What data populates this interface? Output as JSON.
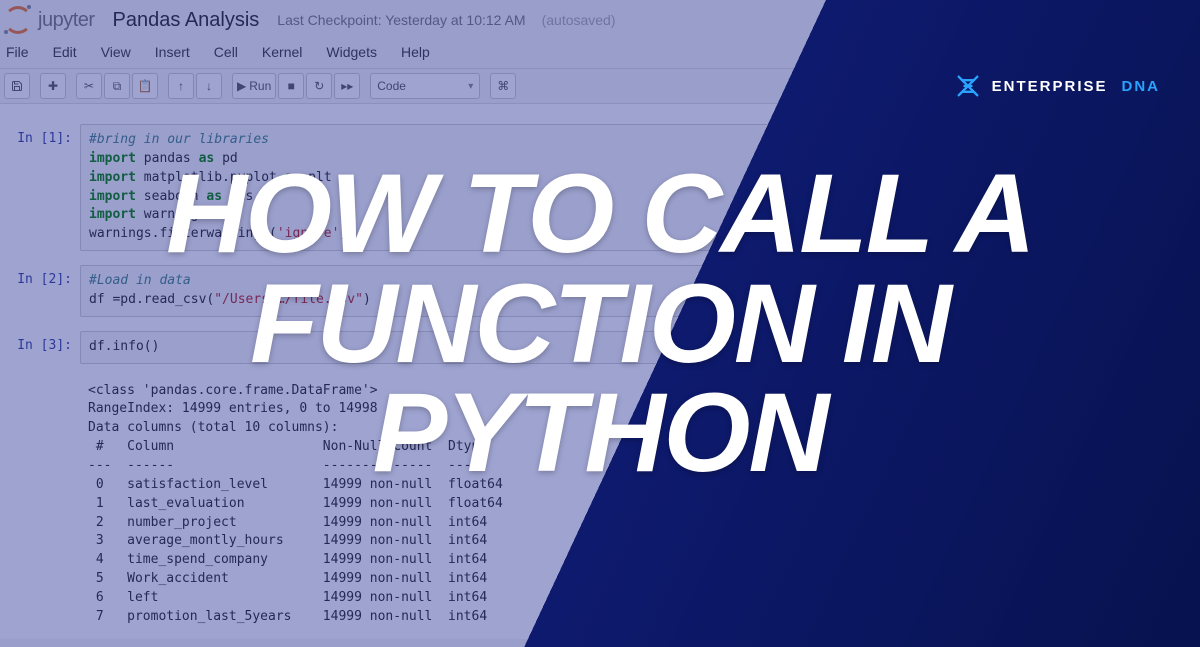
{
  "header": {
    "logo_text": "jupyter",
    "title": "Pandas Analysis",
    "checkpoint": "Last Checkpoint: Yesterday at 10:12 AM",
    "autosaved": "(autosaved)"
  },
  "menubar": [
    "File",
    "Edit",
    "View",
    "Insert",
    "Cell",
    "Kernel",
    "Widgets",
    "Help"
  ],
  "toolbar": {
    "run_label": "Run",
    "cell_type": "Code"
  },
  "cells": [
    {
      "prompt": "In [1]:",
      "kind": "code",
      "lines_html": "<span class='cm'>#bring in our libraries</span>\n<span class='kw'>import</span> pandas <span class='kw'>as</span> pd\n<span class='kw'>import</span> matplotlib.pyplot <span class='kw'>as</span> plt\n<span class='kw'>import</span> seaborn <span class='kw'>as</span> sns\n<span class='kw'>import</span> warnings\nwarnings.filterwarnings(<span class='str'>'ignore'</span>)"
    },
    {
      "prompt": "In [2]:",
      "kind": "code",
      "lines_html": "<span class='cm'>#Load in data</span>\ndf =pd.read_csv(<span class='str'>\"/Users/…/file.csv\"</span>)"
    },
    {
      "prompt": "In [3]:",
      "kind": "code",
      "lines_html": "df.info()"
    },
    {
      "prompt": "",
      "kind": "output",
      "text": "<class 'pandas.core.frame.DataFrame'>\nRangeIndex: 14999 entries, 0 to 14998\nData columns (total 10 columns):\n #   Column                   Non-Null Count  Dtype\n---  ------                   --------------  -----\n 0   satisfaction_level       14999 non-null  float64\n 1   last_evaluation          14999 non-null  float64\n 2   number_project           14999 non-null  int64\n 3   average_montly_hours     14999 non-null  int64\n 4   time_spend_company       14999 non-null  int64\n 5   Work_accident            14999 non-null  int64\n 6   left                     14999 non-null  int64\n 7   promotion_last_5years    14999 non-null  int64"
    }
  ],
  "brand": {
    "name": "ENTERPRISE",
    "suffix": "DNA"
  },
  "hero": {
    "title": "HOW TO CALL A FUNCTION IN PYTHON"
  }
}
